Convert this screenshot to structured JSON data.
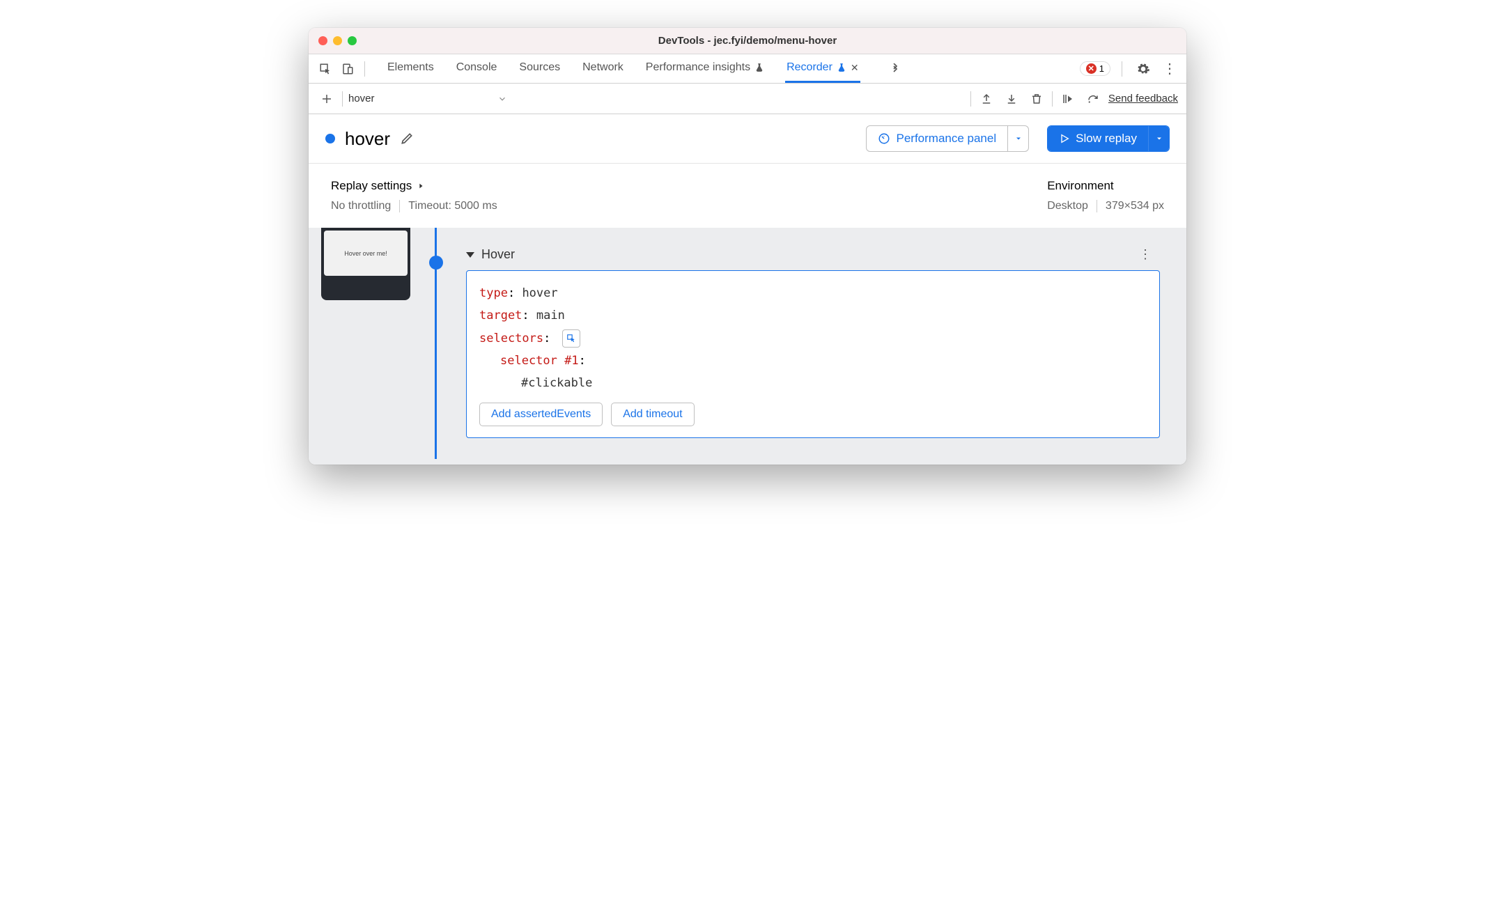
{
  "window": {
    "title": "DevTools - jec.fyi/demo/menu-hover"
  },
  "tabs": {
    "elements": "Elements",
    "console": "Console",
    "sources": "Sources",
    "network": "Network",
    "perfInsights": "Performance insights",
    "recorder": "Recorder"
  },
  "errors": {
    "count": "1"
  },
  "toolbar": {
    "recording_name": "hover",
    "feedback": "Send feedback"
  },
  "header": {
    "recording_title": "hover",
    "perf_btn": "Performance panel",
    "replay_btn": "Slow replay"
  },
  "settings": {
    "replay_label": "Replay settings",
    "throttling": "No throttling",
    "timeout": "Timeout: 5000 ms",
    "env_label": "Environment",
    "env_device": "Desktop",
    "env_size": "379×534 px"
  },
  "thumb": {
    "text": "Hover over me!"
  },
  "step": {
    "title": "Hover",
    "type_key": "type",
    "type_val": "hover",
    "target_key": "target",
    "target_val": "main",
    "selectors_key": "selectors",
    "selector1_key": "selector #1",
    "selector1_val": "#clickable",
    "add_asserted": "Add assertedEvents",
    "add_timeout": "Add timeout"
  }
}
